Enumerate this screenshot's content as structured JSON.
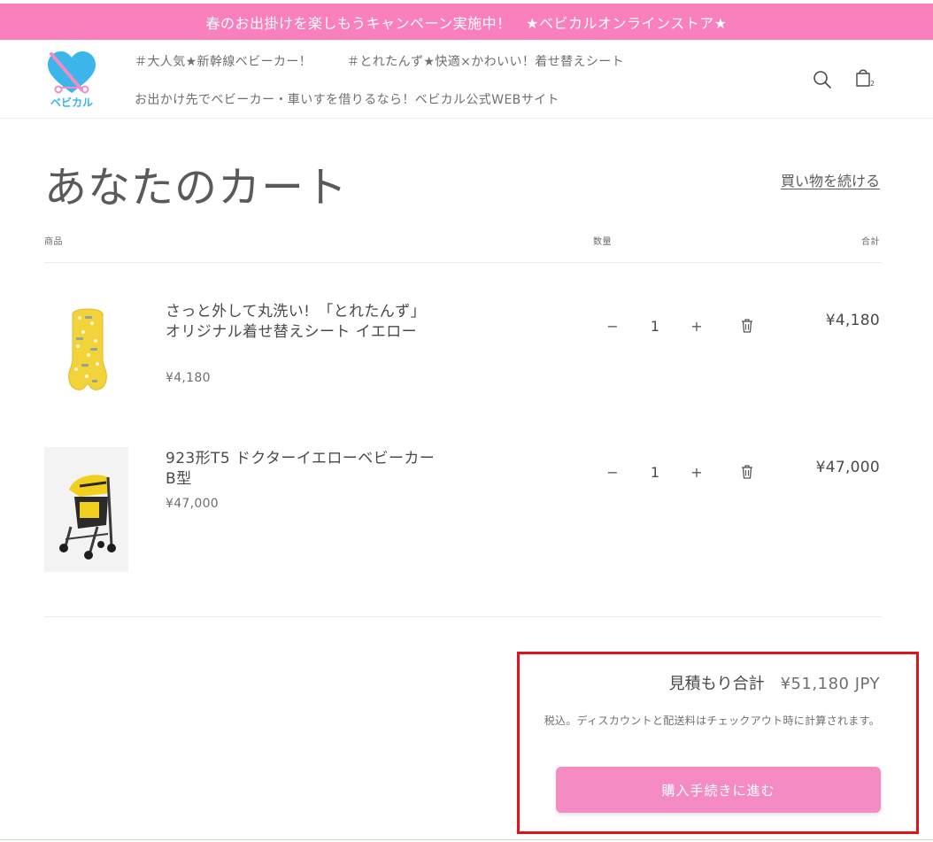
{
  "announcement": "春のお出掛けを楽しもうキャンペーン実施中！　★ベビカルオンラインストア★",
  "header": {
    "logo_text": "ベビカル",
    "nav": [
      "＃大人気★新幹線ベビーカー！",
      "＃とれたんず★快適×かわいい！着せ替えシート",
      "お出かけ先でベビーカー・車いすを借りるなら！ベビカル公式WEBサイト"
    ],
    "search_icon": "search-icon",
    "cart_icon": "cart-icon",
    "cart_count": "2"
  },
  "cart": {
    "title": "あなたのカート",
    "continue_label": "買い物を続ける",
    "columns": {
      "product": "商品",
      "quantity": "数量",
      "total": "合計"
    },
    "items": [
      {
        "name": "さっと外して丸洗い!　「とれたんず」オリジナル着せ替えシート イエロー",
        "unit_price": "¥4,180",
        "quantity": "1",
        "line_total": "¥4,180",
        "decrease": "−",
        "increase": "+"
      },
      {
        "name": "923形T5 ドクターイエローベビーカーB型",
        "unit_price": "¥47,000",
        "quantity": "1",
        "line_total": "¥47,000",
        "decrease": "−",
        "increase": "+"
      }
    ],
    "summary": {
      "label": "見積もり合計",
      "amount": "¥51,180 JPY",
      "note": "税込。ディスカウントと配送料はチェックアウト時に計算されます。",
      "checkout_label": "購入手続きに進む"
    }
  },
  "colors": {
    "announcement_bg": "#f97fbd",
    "checkout_bg": "#f48cc3",
    "highlight_border": "#e0121c",
    "logo_blue": "#3cb6ea"
  }
}
